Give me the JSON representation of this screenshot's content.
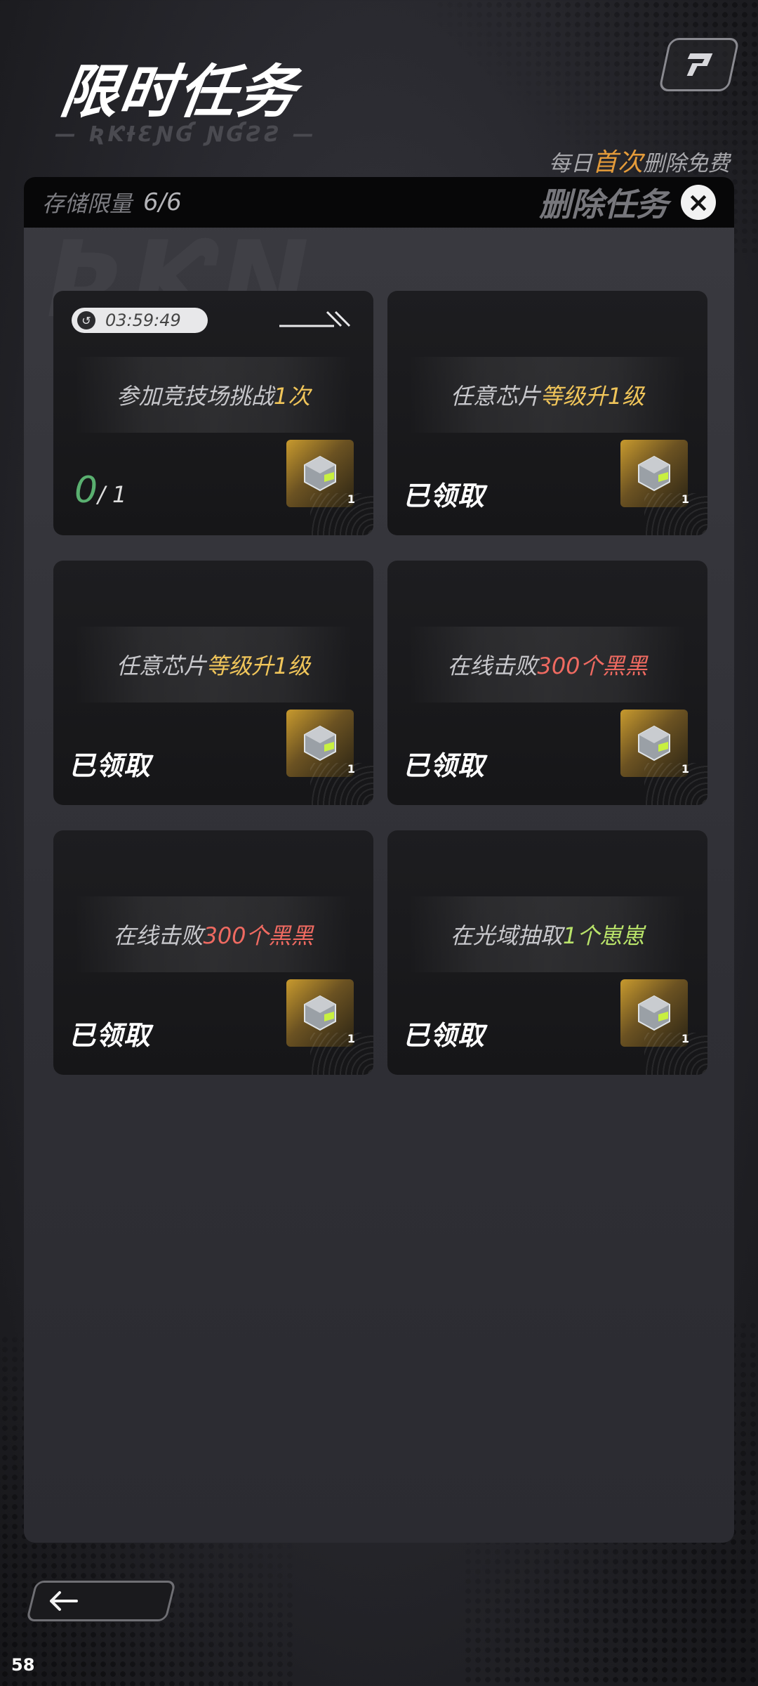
{
  "header": {
    "title": "限时任务",
    "subtitle_deco": "— ƦƘƗƐƝƓ ƝƓƧƧ —",
    "free_note_prefix": "每日",
    "free_note_highlight": "首次",
    "free_note_suffix": "删除免费"
  },
  "panel": {
    "storage_label": "存储限量",
    "storage_value": "6/6",
    "delete_label": "删除任务",
    "close_icon": "×"
  },
  "tasks": [
    {
      "timer": "03:59:49",
      "text_prefix": "参加竞技场挑战",
      "text_highlight": "1次",
      "progress_current": "0",
      "progress_total": "/ 1",
      "reward_count": "1"
    },
    {
      "text_prefix": "任意芯片",
      "text_highlight": "等级升1级",
      "status": "已领取",
      "reward_count": "1"
    },
    {
      "text_prefix": "任意芯片",
      "text_highlight": "等级升1级",
      "status": "已领取",
      "reward_count": "1"
    },
    {
      "text_prefix": "在线击败",
      "text_highlight": "300个黑黑",
      "status": "已领取",
      "reward_count": "1"
    },
    {
      "text_prefix": "在线击败",
      "text_highlight": "300个黑黑",
      "status": "已领取",
      "reward_count": "1"
    },
    {
      "text_prefix": "在光域抽取",
      "text_highlight": "1个崽崽",
      "status": "已领取",
      "reward_count": "1"
    }
  ],
  "footer": {
    "fps": "58"
  }
}
